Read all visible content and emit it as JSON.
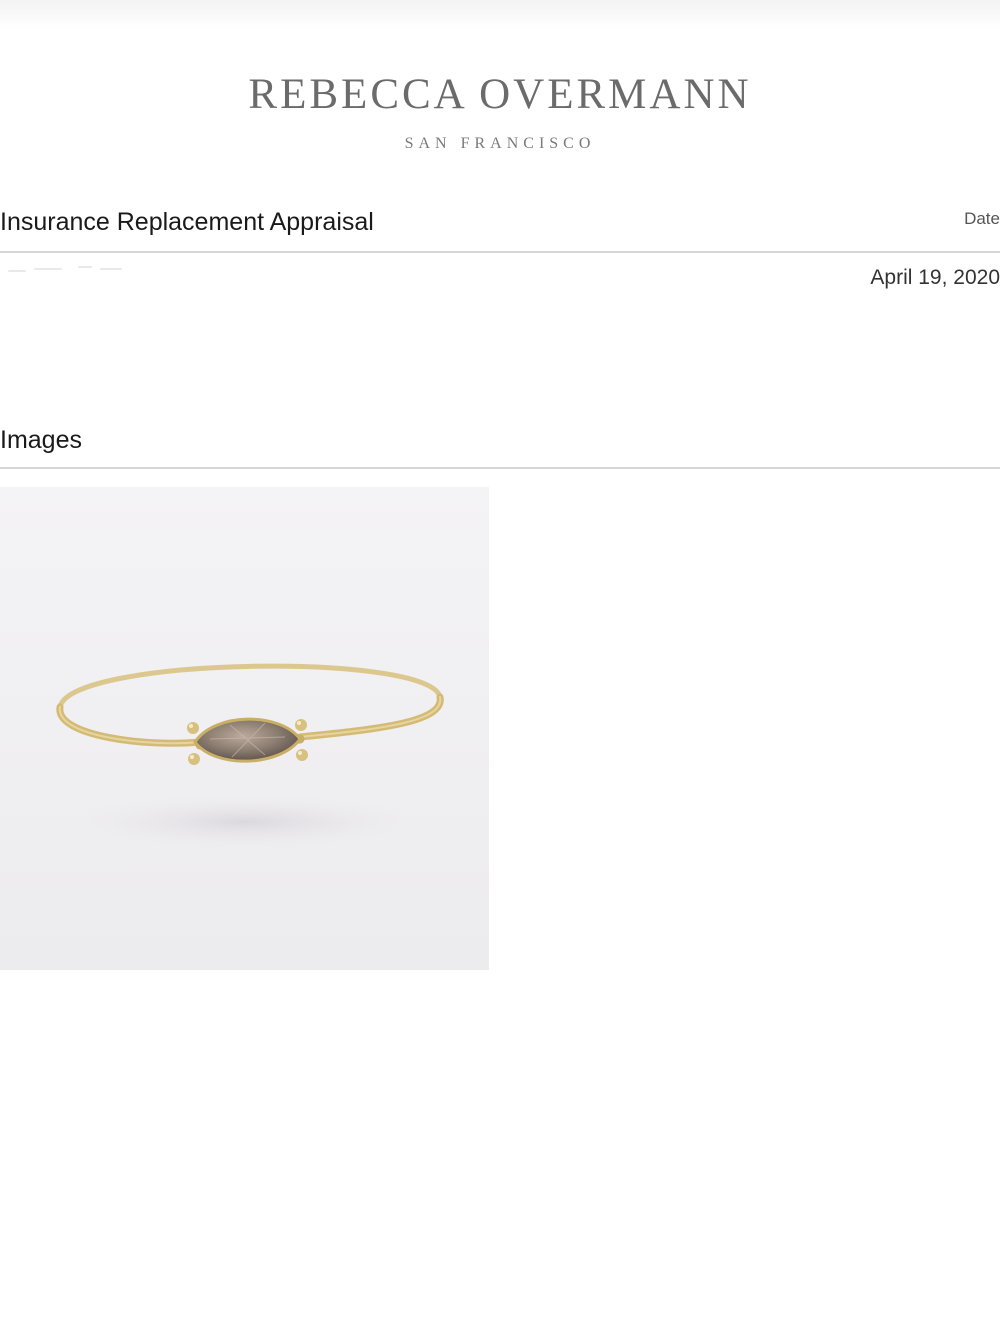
{
  "header": {
    "brand": "REBECCA OVERMANN",
    "location": "SAN FRANCISCO"
  },
  "appraisal": {
    "title": "Insurance Replacement Appraisal",
    "date_label": "Date",
    "date_value": "April 19, 2020"
  },
  "images_section": {
    "title": "Images",
    "photo_subject": "gold ring with marquise champagne diamond"
  },
  "colors": {
    "brand_gray": "#6b6b6b",
    "rule_gray": "#d6d6d6",
    "gold": "#d8c07e",
    "stone": "#8e7f73"
  }
}
